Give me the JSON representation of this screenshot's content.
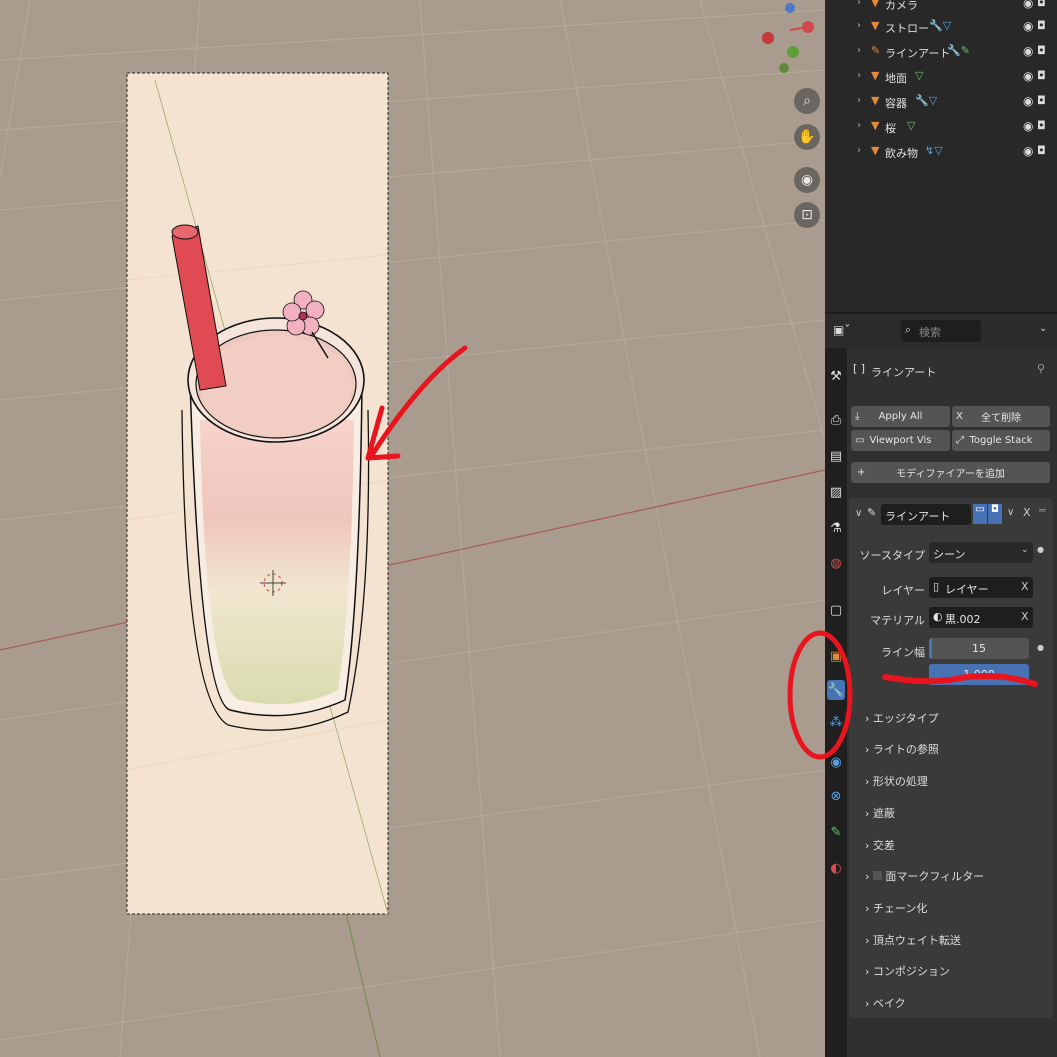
{
  "outliner": {
    "items": [
      {
        "name": "カメラ",
        "icon": "camera-object-icon"
      },
      {
        "name": "ストロー",
        "icon": "mesh-object-icon"
      },
      {
        "name": "ラインアート",
        "icon": "grease-pencil-object-icon"
      },
      {
        "name": "地面",
        "icon": "mesh-object-icon"
      },
      {
        "name": "容器",
        "icon": "mesh-object-icon"
      },
      {
        "name": "桜",
        "icon": "mesh-object-icon"
      },
      {
        "name": "飲み物",
        "icon": "mesh-object-icon"
      }
    ]
  },
  "properties": {
    "search_placeholder": "検索",
    "object_name": "ラインアート",
    "apply_all": "Apply All",
    "delete_all": "全て削除",
    "viewport_vis": "Viewport Vis",
    "toggle_stack": "Toggle Stack",
    "add_modifier": "モディファイアーを追加",
    "modifier_name": "ラインアート",
    "fields": {
      "source_type_label": "ソースタイプ",
      "source_type_value": "シーン",
      "layer_label": "レイヤー",
      "layer_value": "レイヤー",
      "material_label": "マテリアル",
      "material_value": "黒.002",
      "line_width_label": "ライン幅",
      "line_width_value": "15",
      "opacity_value": "1.000"
    },
    "sections": [
      "エッジタイプ",
      "ライトの参照",
      "形状の処理",
      "遮蔽",
      "交差",
      "面マークフィルター",
      "チェーン化",
      "頂点ウェイト転送",
      "コンポジション",
      "ベイク"
    ]
  },
  "colors": {
    "annotation_red": "#e8141e",
    "accent_blue": "#4772b3",
    "straw": "#e04a52"
  }
}
